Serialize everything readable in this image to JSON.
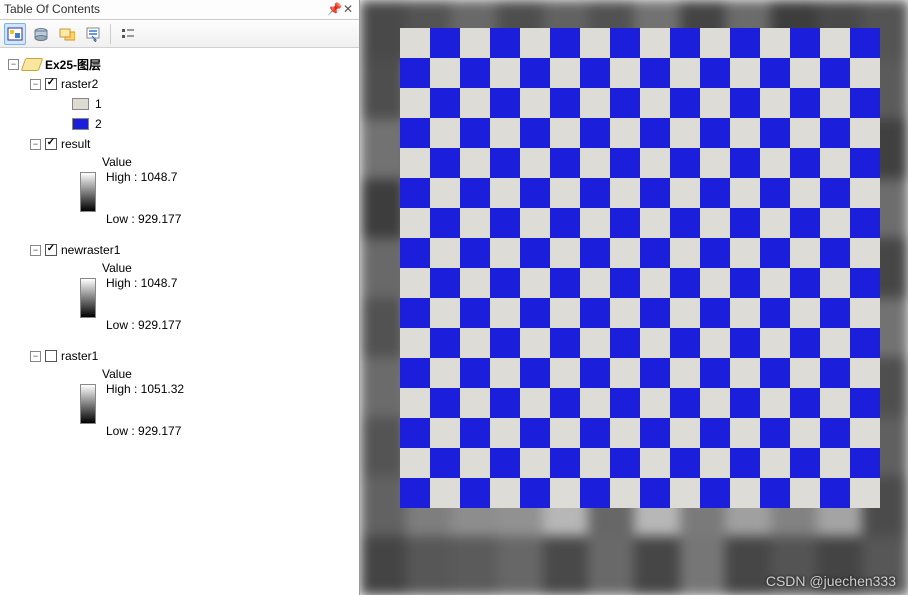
{
  "panel": {
    "title": "Table Of Contents"
  },
  "toolbar": {
    "icons": [
      "list-by-drawing-order",
      "list-by-source",
      "list-by-visibility",
      "list-by-selection",
      "options"
    ]
  },
  "dataframe": {
    "name": "Ex25-图层"
  },
  "layers": [
    {
      "name": "raster2",
      "checked": true,
      "type": "unique",
      "classes": [
        {
          "label": "1",
          "color": "#dedbd2"
        },
        {
          "label": "2",
          "color": "#1b1fdb"
        }
      ]
    },
    {
      "name": "result",
      "checked": true,
      "type": "stretch",
      "value_label": "Value",
      "high_label": "High : 1048.7",
      "low_label": "Low : 929.177"
    },
    {
      "name": "newraster1",
      "checked": true,
      "type": "stretch",
      "value_label": "Value",
      "high_label": "High : 1048.7",
      "low_label": "Low : 929.177"
    },
    {
      "name": "raster1",
      "checked": false,
      "type": "stretch",
      "value_label": "Value",
      "high_label": "High : 1051.32",
      "low_label": "Low : 929.177"
    }
  ],
  "watermark": "CSDN @juechen333",
  "map": {
    "grid_cols": 16,
    "grid_rows": 16,
    "color1": "#1b1fdb",
    "color2": "#dddcd7"
  }
}
